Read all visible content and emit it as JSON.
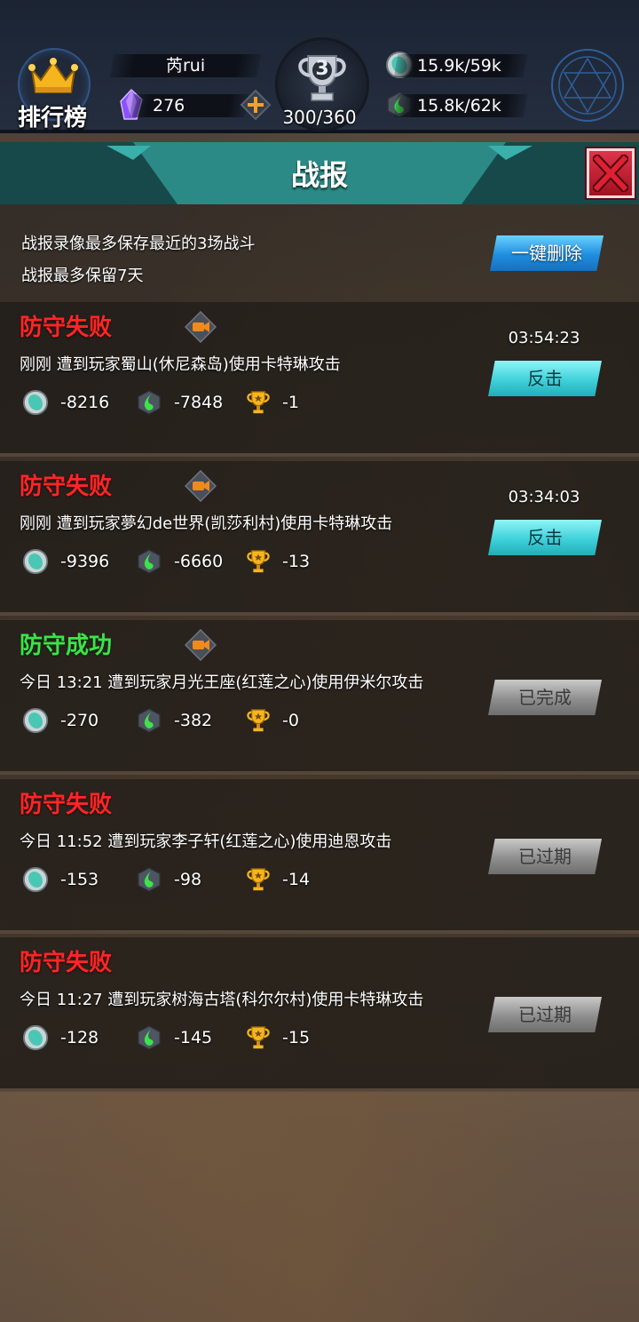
{
  "header": {
    "leaderboard_label": "排行榜",
    "player_name": "芮rui",
    "gems": "276",
    "trophy_level": "3",
    "trophy_progress": "300/360",
    "gold": "15.9k/59k",
    "elixir": "15.8k/62k"
  },
  "dialog": {
    "title": "战报",
    "info_line1": "战报录像最多保存最近的3场战斗",
    "info_line2": "战报最多保留7天",
    "delete_all_label": "一键删除"
  },
  "reports": [
    {
      "status": "防守失败",
      "result": "fail",
      "has_video": true,
      "desc": "刚刚 遭到玩家蜀山(休尼森岛)使用卡特琳攻击",
      "gold": "-8216",
      "elixir": "-7848",
      "trophies": "-1",
      "timer": "03:54:23",
      "action_label": "反击",
      "action_type": "cyan"
    },
    {
      "status": "防守失败",
      "result": "fail",
      "has_video": true,
      "desc": "刚刚 遭到玩家夢幻de世界(凯莎利村)使用卡特琳攻击",
      "gold": "-9396",
      "elixir": "-6660",
      "trophies": "-13",
      "timer": "03:34:03",
      "action_label": "反击",
      "action_type": "cyan"
    },
    {
      "status": "防守成功",
      "result": "win",
      "has_video": true,
      "desc": "今日 13:21 遭到玩家月光王座(红莲之心)使用伊米尔攻击",
      "gold": "-270",
      "elixir": "-382",
      "trophies": "-0",
      "timer": "",
      "action_label": "已完成",
      "action_type": "gray"
    },
    {
      "status": "防守失败",
      "result": "fail",
      "has_video": false,
      "desc": "今日 11:52 遭到玩家李子轩(红莲之心)使用迪恩攻击",
      "gold": "-153",
      "elixir": "-98",
      "trophies": "-14",
      "timer": "",
      "action_label": "已过期",
      "action_type": "gray"
    },
    {
      "status": "防守失败",
      "result": "fail",
      "has_video": false,
      "desc": "今日 11:27 遭到玩家树海古塔(科尔尔村)使用卡特琳攻击",
      "gold": "-128",
      "elixir": "-145",
      "trophies": "-15",
      "timer": "",
      "action_label": "已过期",
      "action_type": "gray"
    }
  ],
  "colors": {
    "fail": "#ff2626",
    "win": "#3ee24a",
    "teal_header": "#2b8a86",
    "close_red": "#c41b2d"
  },
  "icons": {
    "gold": "gold-coin-icon",
    "elixir": "elixir-drop-icon",
    "trophy": "trophy-icon",
    "video": "video-camera-icon",
    "gem": "gem-crystal-icon",
    "crown": "crown-icon",
    "close": "close-icon"
  }
}
